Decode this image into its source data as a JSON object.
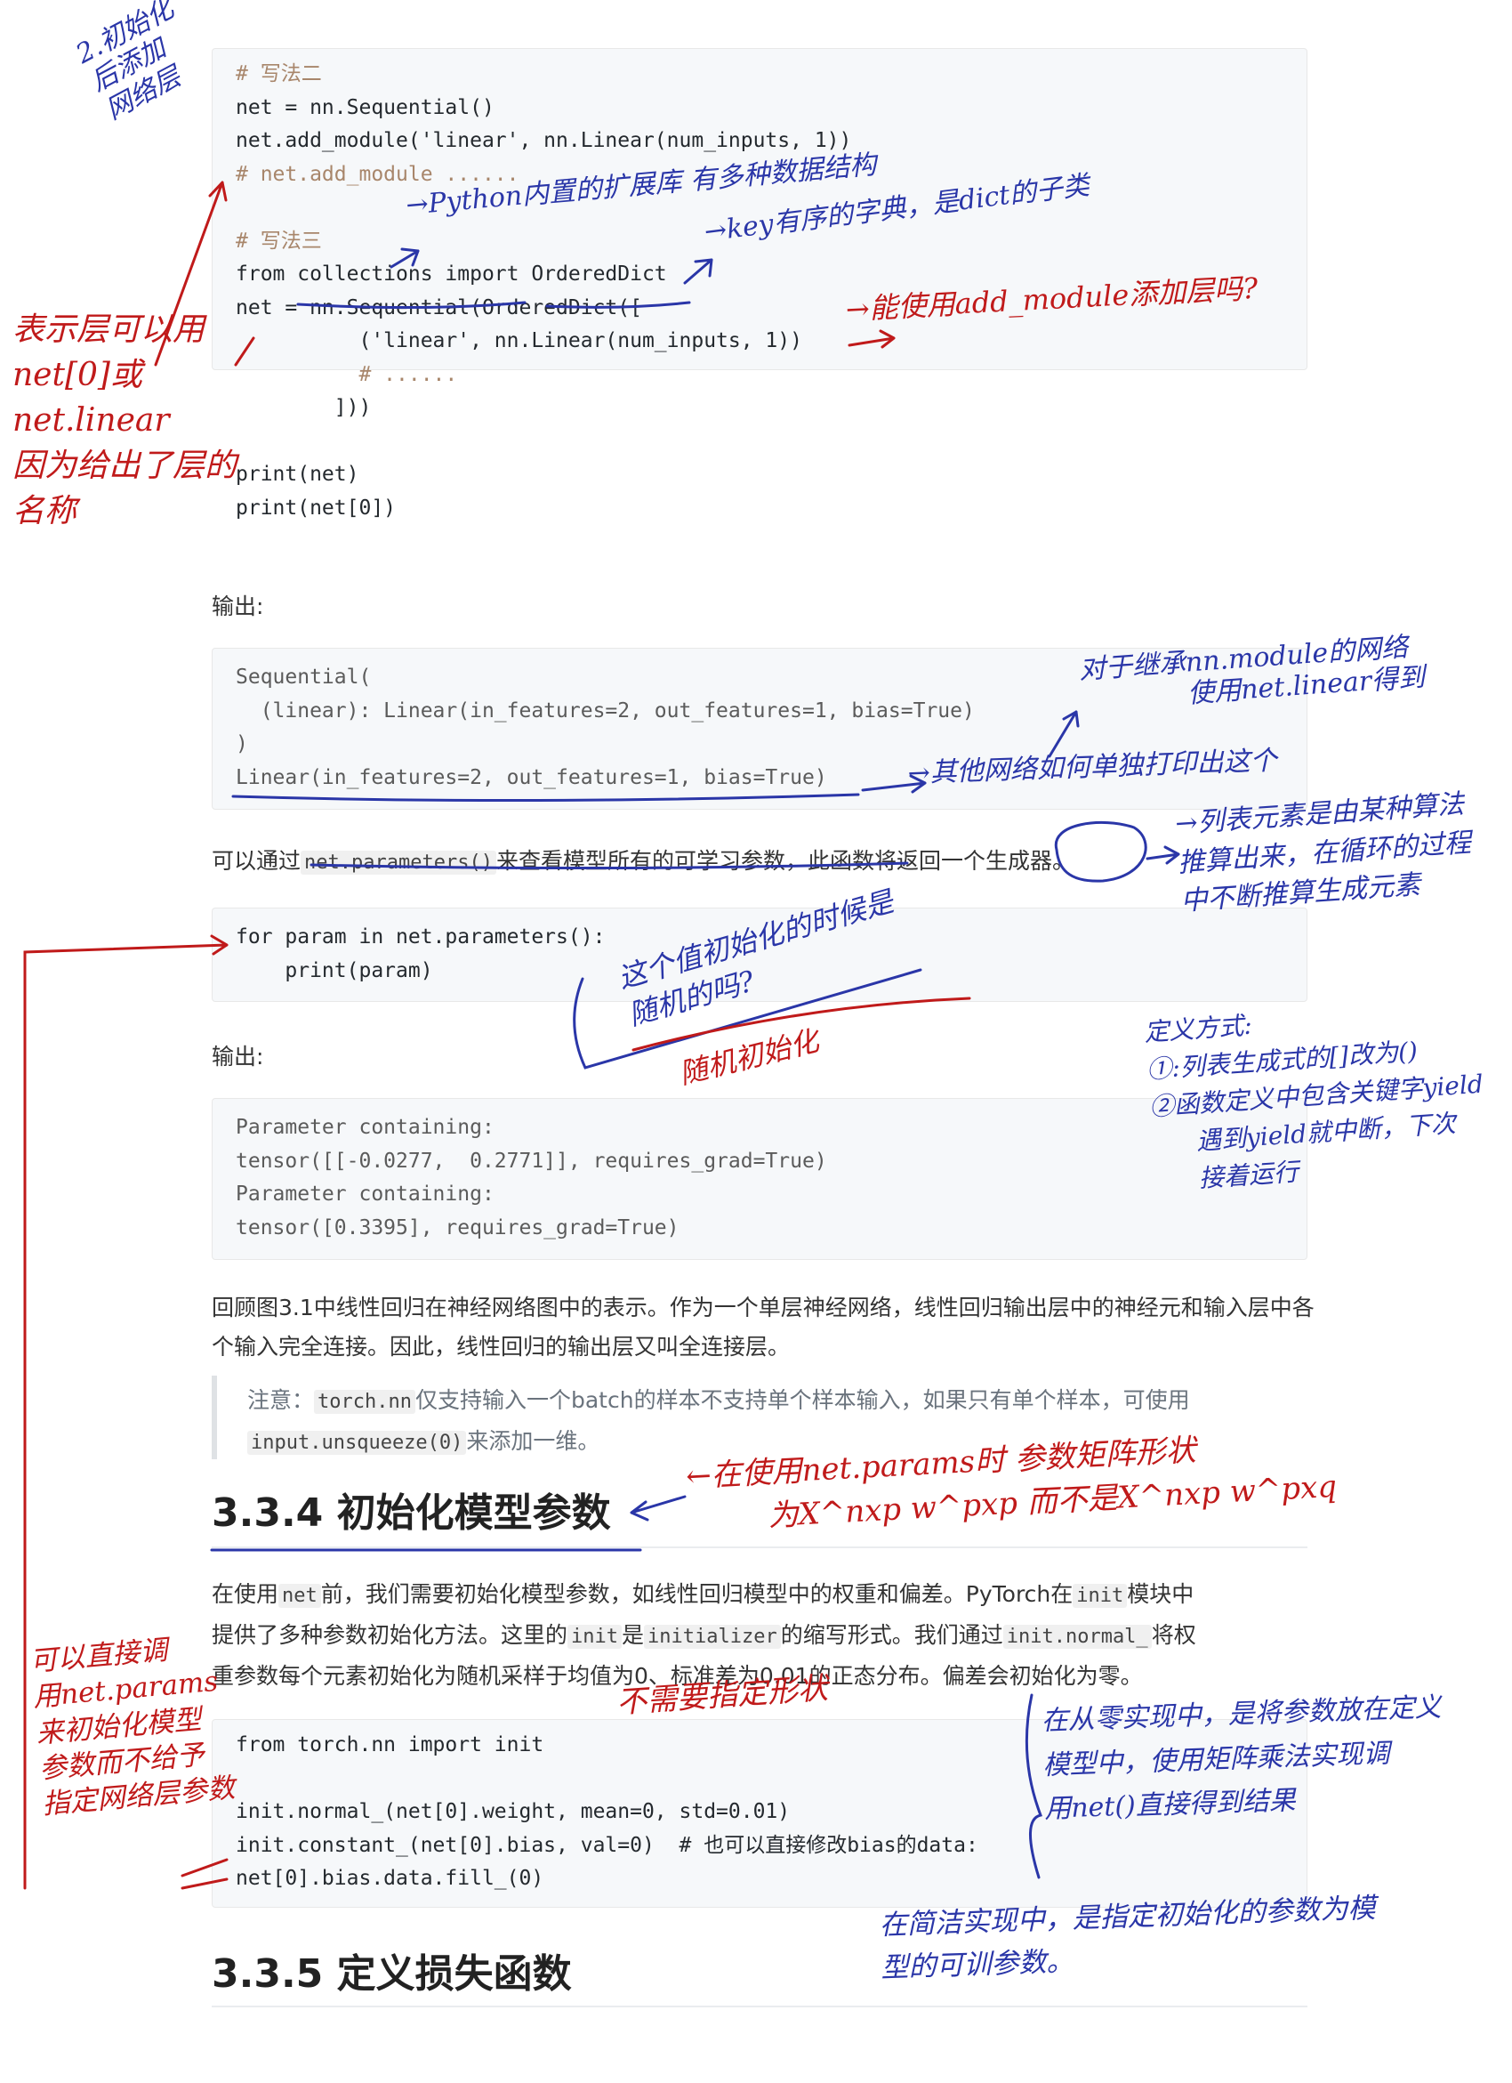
{
  "code1": [
    "# 写法二",
    "net = nn.Sequential()",
    "net.add_module('linear', nn.Linear(num_inputs, 1))",
    "# net.add_module ......",
    "",
    "# 写法三",
    "from collections import OrderedDict",
    "net = nn.Sequential(OrderedDict([",
    "          ('linear', nn.Linear(num_inputs, 1))",
    "          # ......",
    "        ]))",
    "",
    "print(net)",
    "print(net[0])"
  ],
  "output_label": "输出:",
  "output1": [
    "Sequential(",
    "  (linear): Linear(in_features=2, out_features=1, bias=True)",
    ")",
    "Linear(in_features=2, out_features=1, bias=True)"
  ],
  "para_params": {
    "pre": "可以通过",
    "code": "net.parameters()",
    "post": "来查看模型所有的可学习参数，此函数将返回一个生成器。"
  },
  "code2": [
    "for param in net.parameters():",
    "    print(param)"
  ],
  "output2": [
    "Parameter containing:",
    "tensor([[-0.0277,  0.2771]], requires_grad=True)",
    "Parameter containing:",
    "tensor([0.3395], requires_grad=True)"
  ],
  "para_review": "回顾图3.1中线性回归在神经网络图中的表示。作为一个单层神经网络，线性回归输出层中的神经元和输入层中各个输入完全连接。因此，线性回归的输出层又叫全连接层。",
  "note": {
    "prefix": "注意：",
    "code1": "torch.nn",
    "text1": "仅支持输入一个batch的样本不支持单个样本输入，如果只有单个样本，可使用",
    "code2": "input.unsqueeze(0)",
    "text2": "来添加一维。"
  },
  "heading_334": "3.3.4 初始化模型参数",
  "para_init": {
    "t1": "在使用",
    "c1": "net",
    "t2": "前，我们需要初始化模型参数，如线性回归模型中的权重和偏差。PyTorch在",
    "c2": "init",
    "t3": "模块中",
    "t4": "提供了多种参数初始化方法。这里的",
    "c3": "init",
    "t5": "是",
    "c4": "initializer",
    "t6": "的缩写形式。我们通过",
    "c5": "init.normal_",
    "t7": "将权",
    "t8": "重参数每个元素初始化为随机采样于均值为0、标准差为0.01的正态分布。偏差会初始化为零。"
  },
  "code3": [
    "from torch.nn import init",
    "",
    "init.normal_(net[0].weight, mean=0, std=0.01)",
    "init.constant_(net[0].bias, val=0)  # 也可以直接修改bias的data:",
    "net[0].bias.data.fill_(0)"
  ],
  "heading_335": "3.3.5 定义损失函数",
  "annotations": {
    "a_topleft": [
      "2.初始化",
      "后添加",
      "网络层"
    ],
    "a_left": [
      "表示层可以用",
      "net[0]或",
      "net.linear",
      "因为给出了层的",
      "名称"
    ],
    "a_python": "→Python内置的扩展库 有多种数据结构",
    "a_ordered": "→key有序的字典，是dict的子类",
    "a_add": "→能使用add_module添加层吗?",
    "a_net": [
      "对于继承nn.module的网络",
      "使用net.linear得到"
    ],
    "a_print": "→其他网络如何单独打印出这个",
    "a_gen": [
      "→列表元素是由某种算法",
      "推算出来，在循环的过程",
      "中不断推算生成元素"
    ],
    "a_def": [
      "定义方式:",
      "①:列表生成式的[]改为()",
      "②函数定义中包含关键字yield",
      "遇到yield就中断，下次",
      "接着运行"
    ],
    "a_rand": [
      "这个值初始化的时候是",
      "随机的吗?"
    ],
    "a_rand2": "随机初始化",
    "a_heading": "←在使用net.params时 参数矩阵形状",
    "a_heading2": "为X^nxp  w^pxp 而不是X^nxp  w^pxq",
    "a_shape": "不需要指定形状",
    "a_direct": [
      "可以直接调",
      "用net.params",
      "来初始化模型",
      "参数而不给予",
      "指定网络层参数"
    ],
    "a_scratch": [
      "在从零实现中，是将参数放在定义",
      "模型中，使用矩阵乘法实现调",
      "用net()直接得到结果"
    ],
    "a_concise": [
      "在简洁实现中，是指定初始化的参数为模",
      "型的可训参数。"
    ]
  },
  "colors": {
    "pen_blue": "#2a36a8",
    "pen_red": "#c01a1a"
  }
}
